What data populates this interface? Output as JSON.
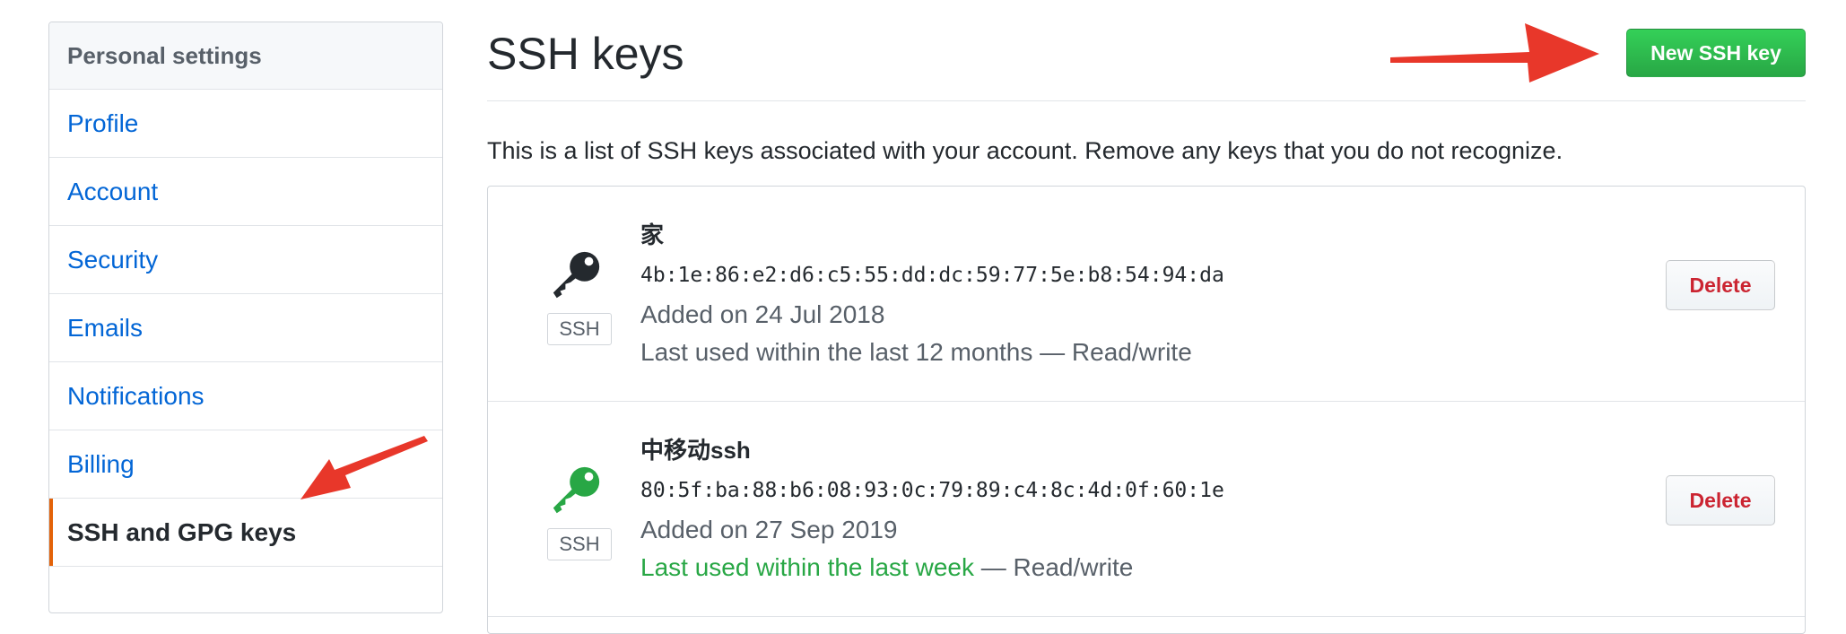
{
  "sidebar": {
    "header": "Personal settings",
    "items": [
      {
        "label": "Profile"
      },
      {
        "label": "Account"
      },
      {
        "label": "Security"
      },
      {
        "label": "Emails"
      },
      {
        "label": "Notifications"
      },
      {
        "label": "Billing"
      },
      {
        "label": "SSH and GPG keys",
        "selected": true
      }
    ]
  },
  "main": {
    "title": "SSH keys",
    "new_key_button": "New SSH key",
    "description": "This is a list of SSH keys associated with your account. Remove any keys that you do not recognize.",
    "keys": [
      {
        "title": "家",
        "fingerprint": "4b:1e:86:e2:d6:c5:55:dd:dc:59:77:5e:b8:54:94:da",
        "added": "Added on 24 Jul 2018",
        "last_used": "Last used within the last 12 months",
        "access": " — Read/write",
        "badge": "SSH",
        "delete_label": "Delete",
        "icon": "key-icon",
        "icon_color": "#24292e"
      },
      {
        "title": "中移动ssh",
        "fingerprint": "80:5f:ba:88:b6:08:93:0c:79:89:c4:8c:4d:0f:60:1e",
        "added": "Added on 27 Sep 2019",
        "last_used": "Last used within the last week",
        "access": " — Read/write",
        "badge": "SSH",
        "delete_label": "Delete",
        "icon": "key-icon",
        "icon_color": "#28a745"
      }
    ]
  },
  "colors": {
    "link": "#0366d6",
    "selected_marker": "#e36209",
    "primary_button": "#28a745",
    "danger_text": "#cb2431",
    "annotation_arrow": "#e8372a"
  }
}
